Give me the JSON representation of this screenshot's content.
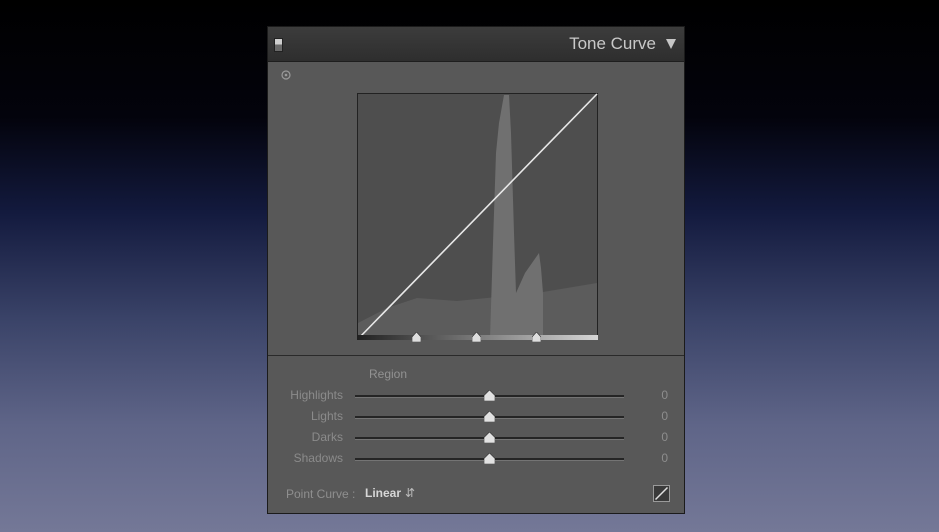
{
  "panel": {
    "title": "Tone Curve",
    "region_label": "Region",
    "sliders": [
      {
        "label": "Highlights",
        "value": "0",
        "position": 0.5
      },
      {
        "label": "Lights",
        "value": "0",
        "position": 0.5
      },
      {
        "label": "Darks",
        "value": "0",
        "position": 0.5
      },
      {
        "label": "Shadows",
        "value": "0",
        "position": 0.5
      }
    ],
    "split_points": [
      0.25,
      0.5,
      0.75
    ],
    "point_curve": {
      "label": "Point Curve :",
      "value": "Linear"
    }
  },
  "icons": {
    "header_switch": "panel-switch-icon",
    "collapse": "triangle-down-icon",
    "targeted_adjustment": "target-adjust-icon",
    "edit_point_curve": "point-curve-edit-icon",
    "select_arrows": "updown-arrows-icon"
  },
  "colors": {
    "panel_bg": "#585858",
    "header_bg": "#333333",
    "curve_line": "#e8e8e8",
    "histogram": "#6d6d6d"
  }
}
